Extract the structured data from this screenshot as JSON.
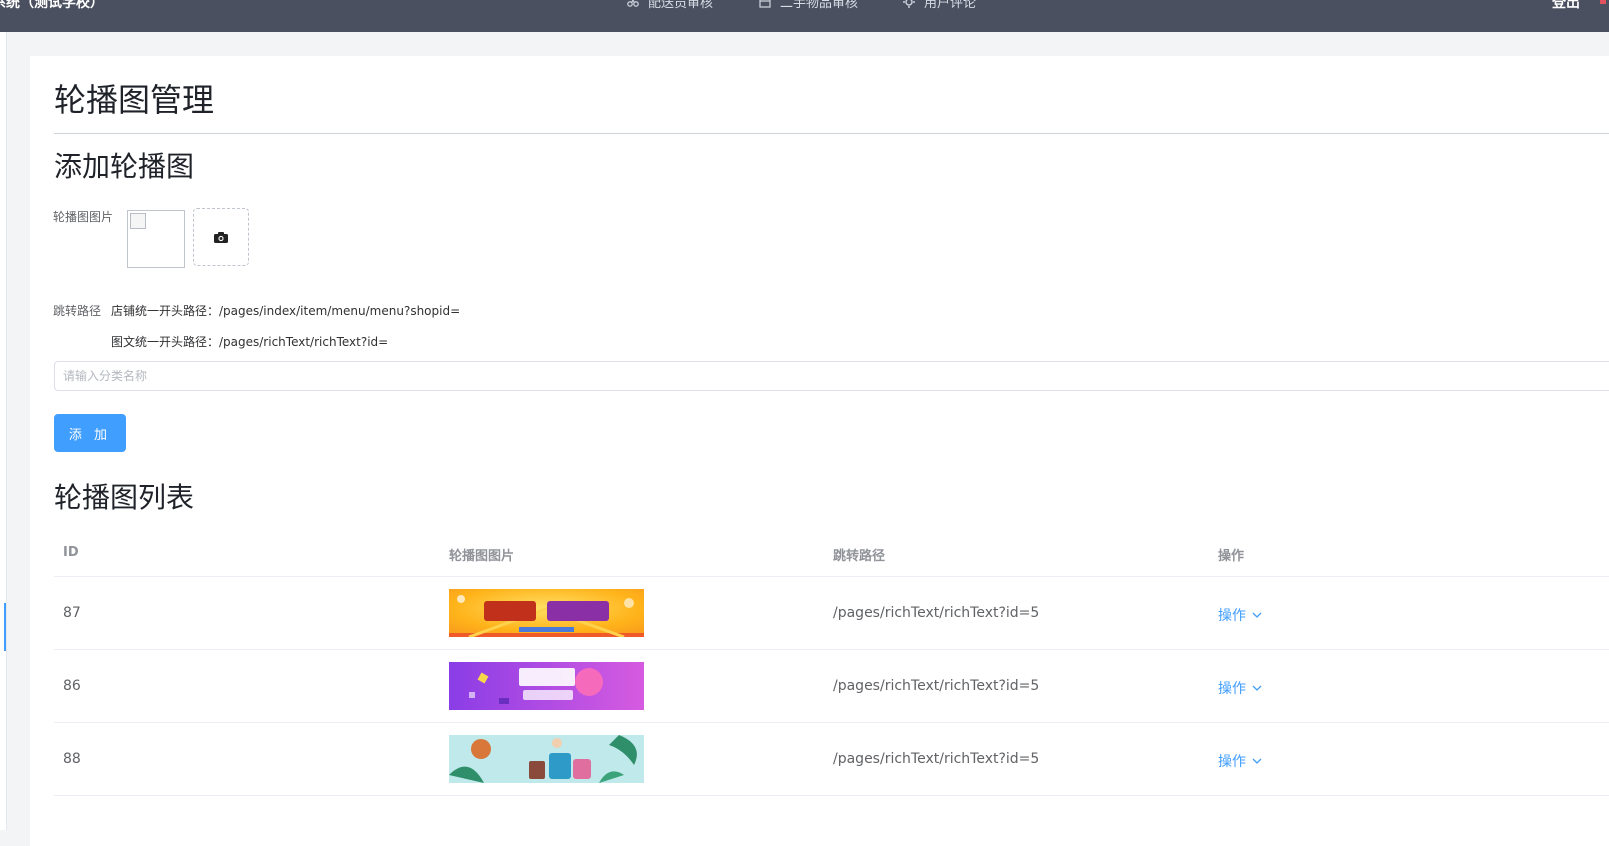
{
  "header": {
    "app_title": "系统（测试学校）",
    "nav": [
      {
        "icon": "scissors-icon",
        "label": "配送员审核"
      },
      {
        "icon": "store-icon",
        "label": "二手物品审核"
      },
      {
        "icon": "gear-icon",
        "label": "用户评论"
      }
    ],
    "user": "登出"
  },
  "page": {
    "title": "轮播图管理",
    "add_section_title": "添加轮播图",
    "image_label": "轮播图图片",
    "path_label": "跳转路径",
    "shop_path_hint": "店铺统一开头路径：/pages/index/item/menu/menu?shopid=",
    "richtext_path_hint": "图文统一开头路径：/pages/richText/richText?id=",
    "input_placeholder": "请输入分类名称",
    "add_button": "添 加",
    "list_title": "轮播图列表"
  },
  "table": {
    "columns": [
      "ID",
      "轮播图图片",
      "跳转路径",
      "操作"
    ],
    "rows": [
      {
        "id": "87",
        "banner": "orange-banner",
        "path": "/pages/richText/richText?id=5",
        "action": "操作"
      },
      {
        "id": "86",
        "banner": "purple-banner",
        "path": "/pages/richText/richText?id=5",
        "action": "操作"
      },
      {
        "id": "88",
        "banner": "teal-banner",
        "path": "/pages/richText/richText?id=5",
        "action": "操作"
      }
    ]
  },
  "colors": {
    "header_bg": "#4a505f",
    "primary": "#409eff",
    "page_bg": "#f3f4f6"
  }
}
